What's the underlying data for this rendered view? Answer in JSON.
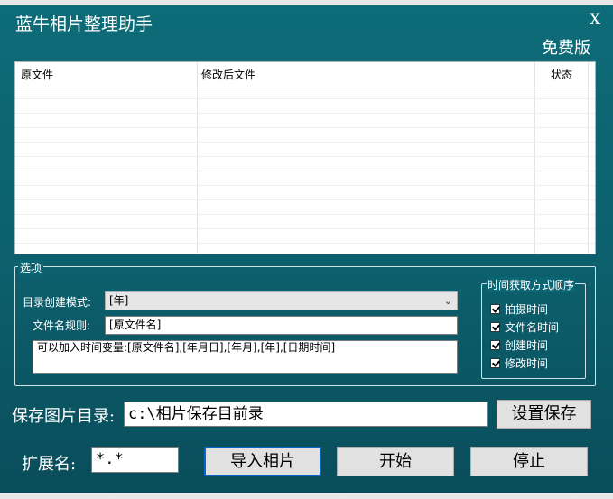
{
  "window": {
    "title": "蓝牛相片整理助手",
    "close_label": "X",
    "edition": "免费版"
  },
  "list": {
    "columns": [
      "原文件",
      "修改后文件",
      "状态"
    ]
  },
  "options": {
    "group_label": "选项",
    "dir_mode_label": "目录创建模式:",
    "dir_mode_value": "[年]",
    "filename_rule_label": "文件名规则:",
    "filename_rule_value": "[原文件名]",
    "hint": "可以加入时间变量:[原文件名],[年月日],[年月],[年],[日期时间]",
    "time_order": {
      "label": "时间获取方式顺序",
      "items": [
        "拍摄时间",
        "文件名时间",
        "创建时间",
        "修改时间"
      ]
    }
  },
  "save": {
    "label": "保存图片目录:",
    "path": "c:\\相片保存目前录",
    "set_button": "设置保存"
  },
  "ext": {
    "label": "扩展名:",
    "value": "*.*"
  },
  "actions": {
    "import": "导入相片",
    "start": "开始",
    "stop": "停止"
  }
}
